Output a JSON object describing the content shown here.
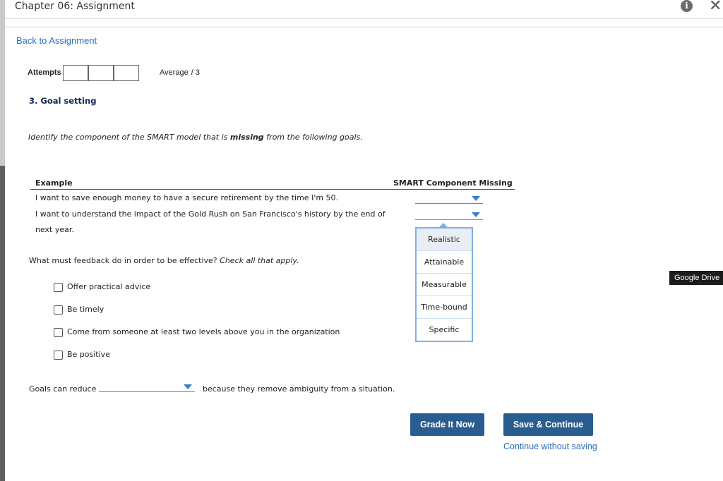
{
  "window": {
    "title": "Chapter 06: Assignment",
    "info_icon": "i",
    "close_icon": "✕"
  },
  "nav": {
    "back_label": "Back to Assignment"
  },
  "score": {
    "attempts_label": "Attempts",
    "average_label": "Average",
    "average_value": "/ 3"
  },
  "question": {
    "number_title": "3. Goal setting",
    "instruction_pre": "Identify the component of the SMART model that is ",
    "instruction_bold": "missing",
    "instruction_post": " from the following goals."
  },
  "table": {
    "col_example": "Example",
    "col_missing": "SMART Component Missing",
    "rows": [
      {
        "text": "I want to save enough money to have a secure retirement by the time I'm 50."
      },
      {
        "text": "I want to understand the impact of the Gold Rush on San Francisco's history by the end of next year."
      }
    ]
  },
  "dropdown_options": [
    "Realistic",
    "Attainable",
    "Measurable",
    "Time-bound",
    "Specific"
  ],
  "feedback_question": {
    "text": "What must feedback do in order to be effective? ",
    "hint": "Check all that apply."
  },
  "checkboxes": [
    {
      "label": "Offer practical advice",
      "checked": false
    },
    {
      "label": "Be timely",
      "checked": false
    },
    {
      "label": "Come from someone at least two levels above you in the organization",
      "checked": false
    },
    {
      "label": "Be positive",
      "checked": false
    }
  ],
  "sentence": {
    "before": "Goals can reduce",
    "after": "because they remove ambiguity from a situation."
  },
  "tooltip": {
    "label": "Google Drive"
  },
  "buttons": {
    "grade": "Grade It Now",
    "save": "Save & Continue",
    "continue_without_saving": "Continue without saving"
  },
  "colors": {
    "accent": "#2a5d8f",
    "link": "#2a6ebb",
    "dropdown_line": "#4d8fd1"
  }
}
